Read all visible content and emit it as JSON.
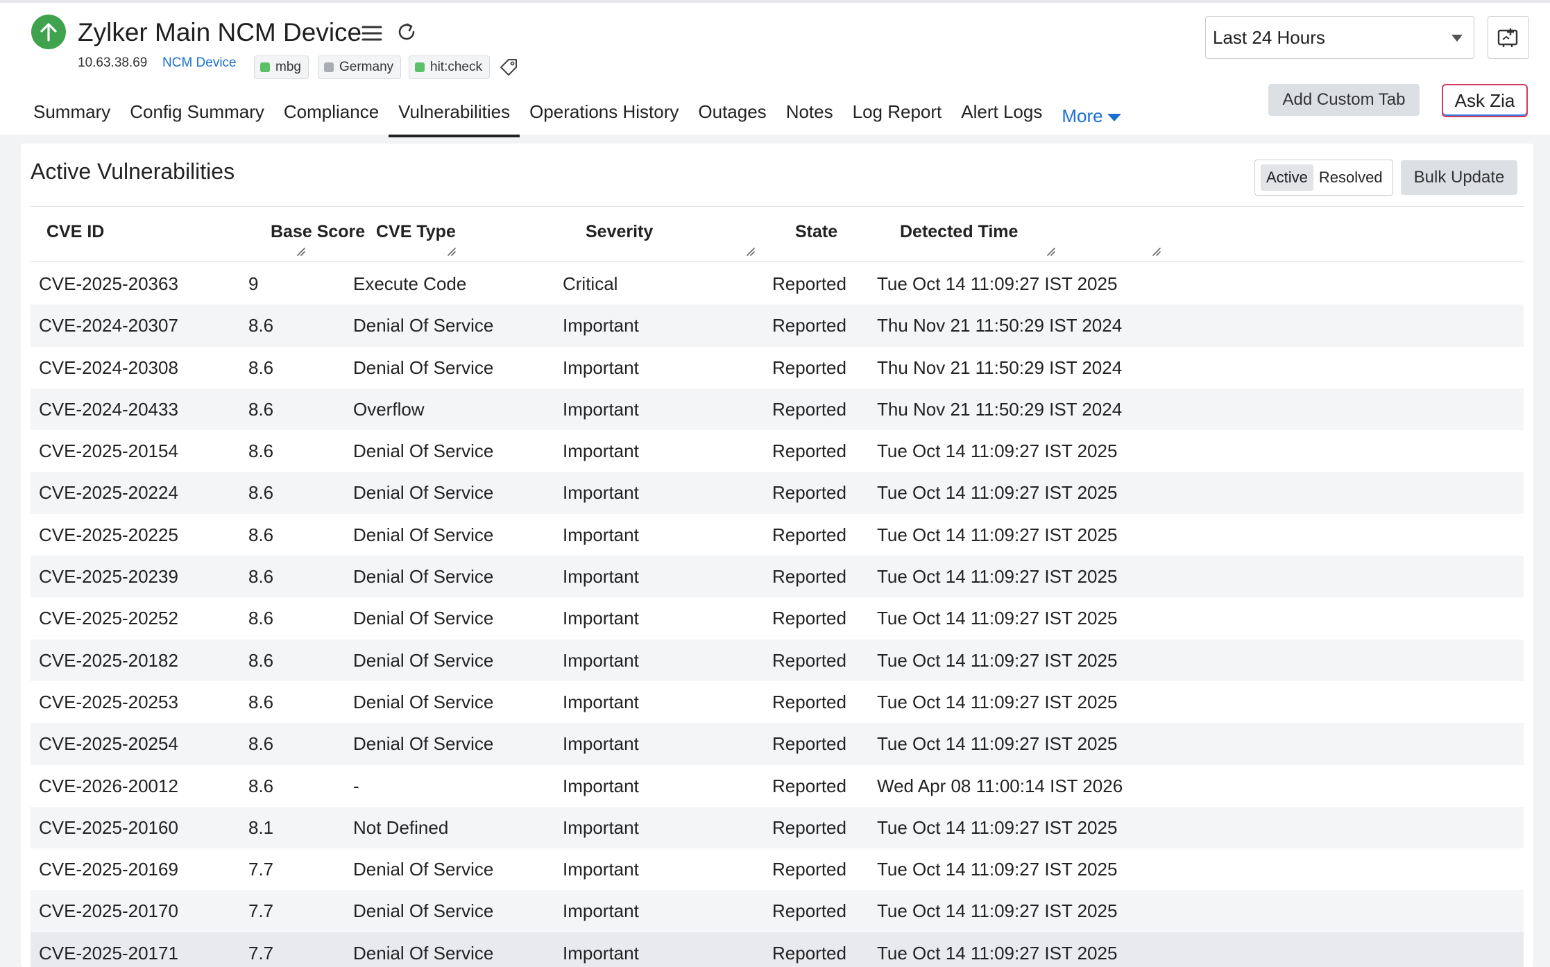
{
  "device": {
    "title": "Zylker Main NCM Device",
    "ip": "10.63.38.69",
    "type": "NCM Device",
    "status_color": "#3fa34d",
    "tags": [
      {
        "label": "mbg",
        "color": "#5cc06a"
      },
      {
        "label": "Germany",
        "color": "#a9acb1"
      },
      {
        "label": "hit:check",
        "color": "#5cc06a"
      }
    ]
  },
  "period": {
    "value": "Last 24 Hours"
  },
  "tabs": [
    {
      "label": "Summary"
    },
    {
      "label": "Config Summary"
    },
    {
      "label": "Compliance"
    },
    {
      "label": "Vulnerabilities",
      "active": true
    },
    {
      "label": "Operations History"
    },
    {
      "label": "Outages"
    },
    {
      "label": "Notes"
    },
    {
      "label": "Log Report"
    },
    {
      "label": "Alert Logs"
    }
  ],
  "more_label": "More",
  "actions": {
    "custom_tab": "Add Custom Tab",
    "ask_zia": "Ask Zia"
  },
  "panel": {
    "title": "Active Vulnerabilities",
    "toggle": {
      "active": "Active",
      "resolved": "Resolved"
    },
    "bulk_update": "Bulk Update"
  },
  "table": {
    "columns": [
      "CVE ID",
      "Base Score",
      "CVE Type",
      "Severity",
      "State",
      "Detected Time"
    ],
    "rows": [
      [
        "CVE-2025-20363",
        "9",
        "Execute Code",
        "Critical",
        "Reported",
        "Tue Oct 14 11:09:27 IST 2025"
      ],
      [
        "CVE-2024-20307",
        "8.6",
        "Denial Of Service",
        "Important",
        "Reported",
        "Thu Nov 21 11:50:29 IST 2024"
      ],
      [
        "CVE-2024-20308",
        "8.6",
        "Denial Of Service",
        "Important",
        "Reported",
        "Thu Nov 21 11:50:29 IST 2024"
      ],
      [
        "CVE-2024-20433",
        "8.6",
        "Overflow",
        "Important",
        "Reported",
        "Thu Nov 21 11:50:29 IST 2024"
      ],
      [
        "CVE-2025-20154",
        "8.6",
        "Denial Of Service",
        "Important",
        "Reported",
        "Tue Oct 14 11:09:27 IST 2025"
      ],
      [
        "CVE-2025-20224",
        "8.6",
        "Denial Of Service",
        "Important",
        "Reported",
        "Tue Oct 14 11:09:27 IST 2025"
      ],
      [
        "CVE-2025-20225",
        "8.6",
        "Denial Of Service",
        "Important",
        "Reported",
        "Tue Oct 14 11:09:27 IST 2025"
      ],
      [
        "CVE-2025-20239",
        "8.6",
        "Denial Of Service",
        "Important",
        "Reported",
        "Tue Oct 14 11:09:27 IST 2025"
      ],
      [
        "CVE-2025-20252",
        "8.6",
        "Denial Of Service",
        "Important",
        "Reported",
        "Tue Oct 14 11:09:27 IST 2025"
      ],
      [
        "CVE-2025-20182",
        "8.6",
        "Denial Of Service",
        "Important",
        "Reported",
        "Tue Oct 14 11:09:27 IST 2025"
      ],
      [
        "CVE-2025-20253",
        "8.6",
        "Denial Of Service",
        "Important",
        "Reported",
        "Tue Oct 14 11:09:27 IST 2025"
      ],
      [
        "CVE-2025-20254",
        "8.6",
        "Denial Of Service",
        "Important",
        "Reported",
        "Tue Oct 14 11:09:27 IST 2025"
      ],
      [
        "CVE-2026-20012",
        "8.6",
        "-",
        "Important",
        "Reported",
        "Wed Apr 08 11:00:14 IST 2026"
      ],
      [
        "CVE-2025-20160",
        "8.1",
        "Not Defined",
        "Important",
        "Reported",
        "Tue Oct 14 11:09:27 IST 2025"
      ],
      [
        "CVE-2025-20169",
        "7.7",
        "Denial Of Service",
        "Important",
        "Reported",
        "Tue Oct 14 11:09:27 IST 2025"
      ],
      [
        "CVE-2025-20170",
        "7.7",
        "Denial Of Service",
        "Important",
        "Reported",
        "Tue Oct 14 11:09:27 IST 2025"
      ],
      [
        "CVE-2025-20171",
        "7.7",
        "Denial Of Service",
        "Important",
        "Reported",
        "Tue Oct 14 11:09:27 IST 2025"
      ]
    ]
  }
}
